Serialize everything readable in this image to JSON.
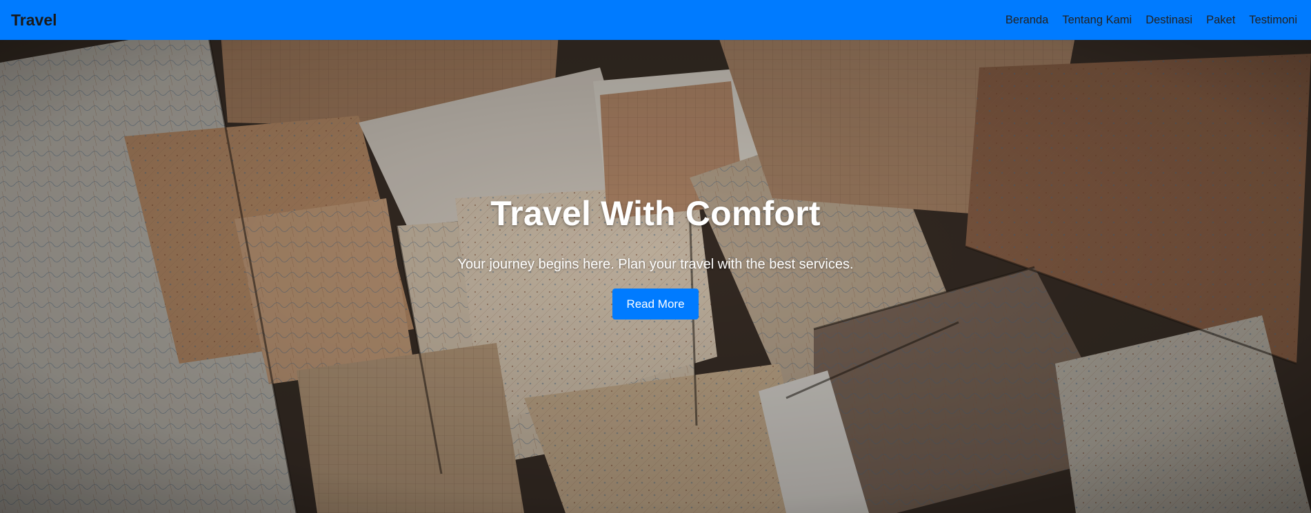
{
  "navbar": {
    "brand": "Travel",
    "links": [
      "Beranda",
      "Tentang Kami",
      "Destinasi",
      "Paket",
      "Testimoni"
    ]
  },
  "hero": {
    "background": "scattered-vintage-maps-photo",
    "title": "Travel With Comfort",
    "subtitle": "Your journey begins here. Plan your travel with the best services.",
    "button_label": "Read More"
  },
  "colors": {
    "accent": "#007bff",
    "hero_text": "#ffffff"
  }
}
